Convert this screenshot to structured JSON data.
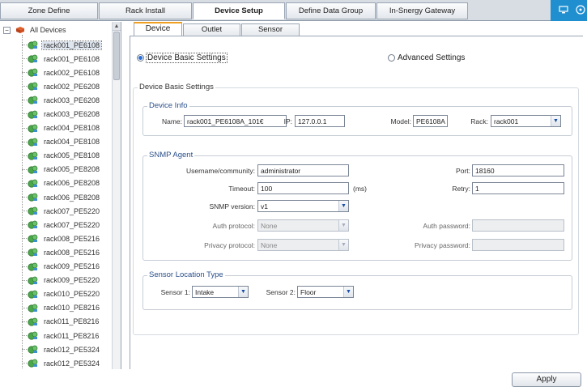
{
  "top_tabs": [
    {
      "label": "Zone Define"
    },
    {
      "label": "Rack Install"
    },
    {
      "label": "Device Setup"
    },
    {
      "label": "Define Data Group"
    },
    {
      "label": "In-Snergy Gateway"
    }
  ],
  "tree": {
    "root_label": "All Devices",
    "items": [
      "rack001_PE6108",
      "rack001_PE6108",
      "rack002_PE6108",
      "rack002_PE6208",
      "rack003_PE6208",
      "rack003_PE6208",
      "rack004_PE8108",
      "rack004_PE8108",
      "rack005_PE8108",
      "rack005_PE8208",
      "rack006_PE8208",
      "rack006_PE8208",
      "rack007_PE5220",
      "rack007_PE5220",
      "rack008_PE5216",
      "rack008_PE5216",
      "rack009_PE5216",
      "rack009_PE5220",
      "rack010_PE5220",
      "rack010_PE8216",
      "rack011_PE8216",
      "rack011_PE8216",
      "rack012_PE5324",
      "rack012_PE5324"
    ]
  },
  "sub_tabs": [
    {
      "label": "Device"
    },
    {
      "label": "Outlet"
    },
    {
      "label": "Sensor"
    }
  ],
  "settings_mode": {
    "basic_label": "Device Basic Settings",
    "advanced_label": "Advanced Settings",
    "selected": "basic"
  },
  "section_title": "Device Basic Settings",
  "device_info": {
    "title": "Device Info",
    "name_label": "Name:",
    "name_value": "rack001_PE6108A_101€",
    "ip_label": "IP:",
    "ip_value": "127.0.0.1",
    "model_label": "Model:",
    "model_value": "PE6108A",
    "rack_label": "Rack:",
    "rack_value": "rack001"
  },
  "snmp": {
    "title": "SNMP Agent",
    "username_label": "Username/community:",
    "username_value": "administrator",
    "port_label": "Port:",
    "port_value": "18160",
    "timeout_label": "Timeout:",
    "timeout_value": "100",
    "timeout_unit": "(ms)",
    "retry_label": "Retry:",
    "retry_value": "1",
    "version_label": "SNMP version:",
    "version_value": "v1",
    "auth_protocol_label": "Auth protocol:",
    "auth_protocol_value": "None",
    "auth_password_label": "Auth password:",
    "auth_password_value": "",
    "privacy_protocol_label": "Privacy protocol:",
    "privacy_protocol_value": "None",
    "privacy_password_label": "Privacy password:",
    "privacy_password_value": ""
  },
  "sensor_location": {
    "title": "Sensor Location Type",
    "sensor1_label": "Sensor 1:",
    "sensor1_value": "Intake",
    "sensor2_label": "Sensor 2:",
    "sensor2_value": "Floor"
  },
  "apply_label": "Apply",
  "colors": {
    "accent": "#1f8fd0",
    "tab_highlight": "#f0a020",
    "group_title": "#2a4f8a"
  }
}
